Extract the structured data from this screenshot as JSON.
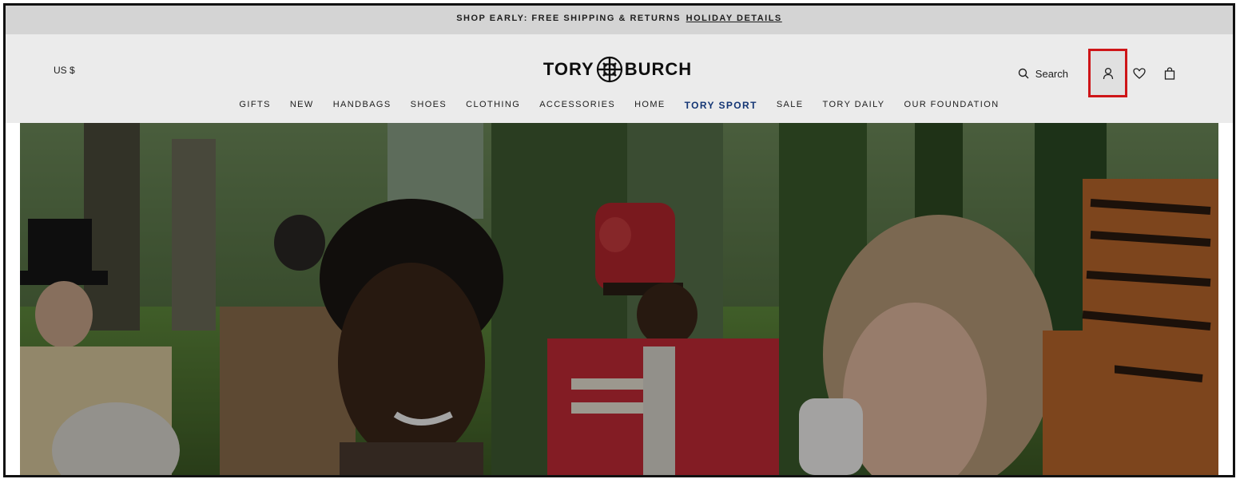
{
  "banner": {
    "text": "SHOP EARLY: FREE SHIPPING & RETURNS",
    "link": "HOLIDAY DETAILS"
  },
  "header": {
    "currency": "US $",
    "logo_left": "TORY",
    "logo_right": "BURCH",
    "search_label": "Search"
  },
  "nav": {
    "items": [
      "GIFTS",
      "NEW",
      "HANDBAGS",
      "SHOES",
      "CLOTHING",
      "ACCESSORIES",
      "HOME",
      "TORY SPORT",
      "SALE",
      "TORY DAILY",
      "OUR FOUNDATION"
    ]
  },
  "colors": {
    "highlight": "#e0171b",
    "sport": "#153a7e"
  }
}
